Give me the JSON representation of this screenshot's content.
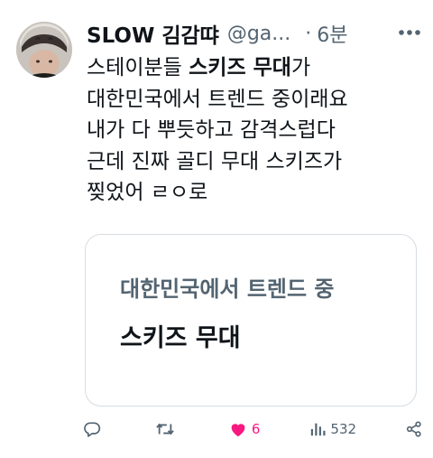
{
  "tweet": {
    "display_name": "SLOW 김감땨",
    "handle": "@ga...",
    "separator": "·",
    "time": "6분",
    "body_lines": [
      {
        "pre": "스테이분들 ",
        "bold": "스키즈 무대",
        "post": "가"
      },
      {
        "pre": "대한민국에서 트렌드 중이래요",
        "bold": "",
        "post": ""
      },
      {
        "pre": "내가 다 뿌듯하고 감격스럽다",
        "bold": "",
        "post": ""
      },
      {
        "pre": "근데 진짜 골디 무대 스키즈가",
        "bold": "",
        "post": ""
      },
      {
        "pre": "찢었어 ㄹㅇ로",
        "bold": "",
        "post": ""
      }
    ],
    "card": {
      "subtitle": "대한민국에서 트렌드 중",
      "title": "스키즈 무대"
    },
    "actions": {
      "reply_count": "",
      "retweet_count": "",
      "like_count": "6",
      "views_count": "532"
    },
    "colors": {
      "text": "#0f1419",
      "secondary": "#536471",
      "like": "#f91880",
      "border": "#d7dde2"
    },
    "icons": [
      "avatar",
      "more-icon",
      "reply-icon",
      "retweet-icon",
      "heart-icon",
      "views-icon",
      "share-icon"
    ]
  }
}
